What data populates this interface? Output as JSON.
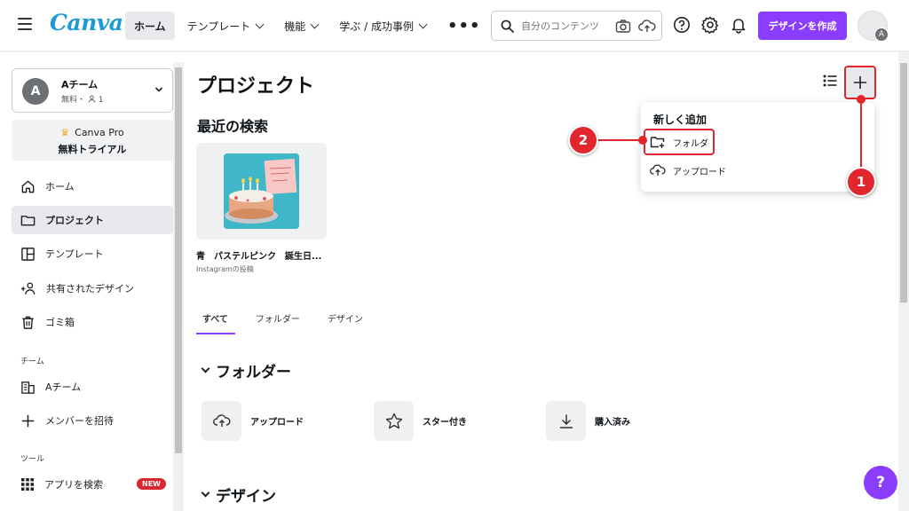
{
  "brand": {
    "logo": "Canva",
    "accent": "#8b3dff",
    "logo_color": "#1a9bd7",
    "marker_color": "#e1262d"
  },
  "topnav": {
    "items": [
      {
        "label": "ホーム",
        "active": true
      },
      {
        "label": "テンプレート",
        "dropdown": true
      },
      {
        "label": "機能",
        "dropdown": true
      },
      {
        "label": "学ぶ / 成功事例",
        "dropdown": true
      }
    ],
    "more": "•••"
  },
  "search": {
    "placeholder": "自分のコンテンツ"
  },
  "header": {
    "create_label": "デザインを作成",
    "avatar_initial": "A"
  },
  "team": {
    "initial": "A",
    "name": "Aチーム",
    "plan": "無料・",
    "members": "1"
  },
  "pro": {
    "line1": "Canva Pro",
    "line2": "無料トライアル"
  },
  "sidebar": {
    "items": [
      {
        "label": "ホーム",
        "icon": "home-icon"
      },
      {
        "label": "プロジェクト",
        "icon": "folder-icon",
        "active": true
      },
      {
        "label": "テンプレート",
        "icon": "template-icon"
      },
      {
        "label": "共有されたデザイン",
        "icon": "shared-icon"
      },
      {
        "label": "ゴミ箱",
        "icon": "trash-icon"
      }
    ],
    "team_heading": "チーム",
    "team_items": [
      {
        "label": "Aチーム",
        "icon": "building-icon"
      },
      {
        "label": "メンバーを招待",
        "icon": "plus-icon"
      }
    ],
    "tools_heading": "ツール",
    "tools_items": [
      {
        "label": "アプリを検索",
        "icon": "apps-grid-icon",
        "badge": "NEW"
      }
    ]
  },
  "main": {
    "title": "プロジェクト",
    "recent_title": "最近の検索",
    "recent": [
      {
        "name": "青　パステルピンク　誕生日...",
        "type": "Instagramの投稿"
      }
    ],
    "tabs": [
      {
        "label": "すべて",
        "active": true
      },
      {
        "label": "フォルダー"
      },
      {
        "label": "デザイン"
      }
    ],
    "folders_heading": "フォルダー",
    "folders": [
      {
        "label": "アップロード",
        "icon": "cloud-upload-icon"
      },
      {
        "label": "スター付き",
        "icon": "star-icon"
      },
      {
        "label": "購入済み",
        "icon": "download-icon"
      }
    ],
    "designs_heading": "デザイン"
  },
  "dropdown": {
    "title": "新しく追加",
    "items": [
      {
        "label": "フォルダ",
        "icon": "folder-plus-icon"
      },
      {
        "label": "アップロード",
        "icon": "cloud-upload-icon"
      }
    ]
  },
  "markers": {
    "one": "1",
    "two": "2"
  },
  "help": "?"
}
